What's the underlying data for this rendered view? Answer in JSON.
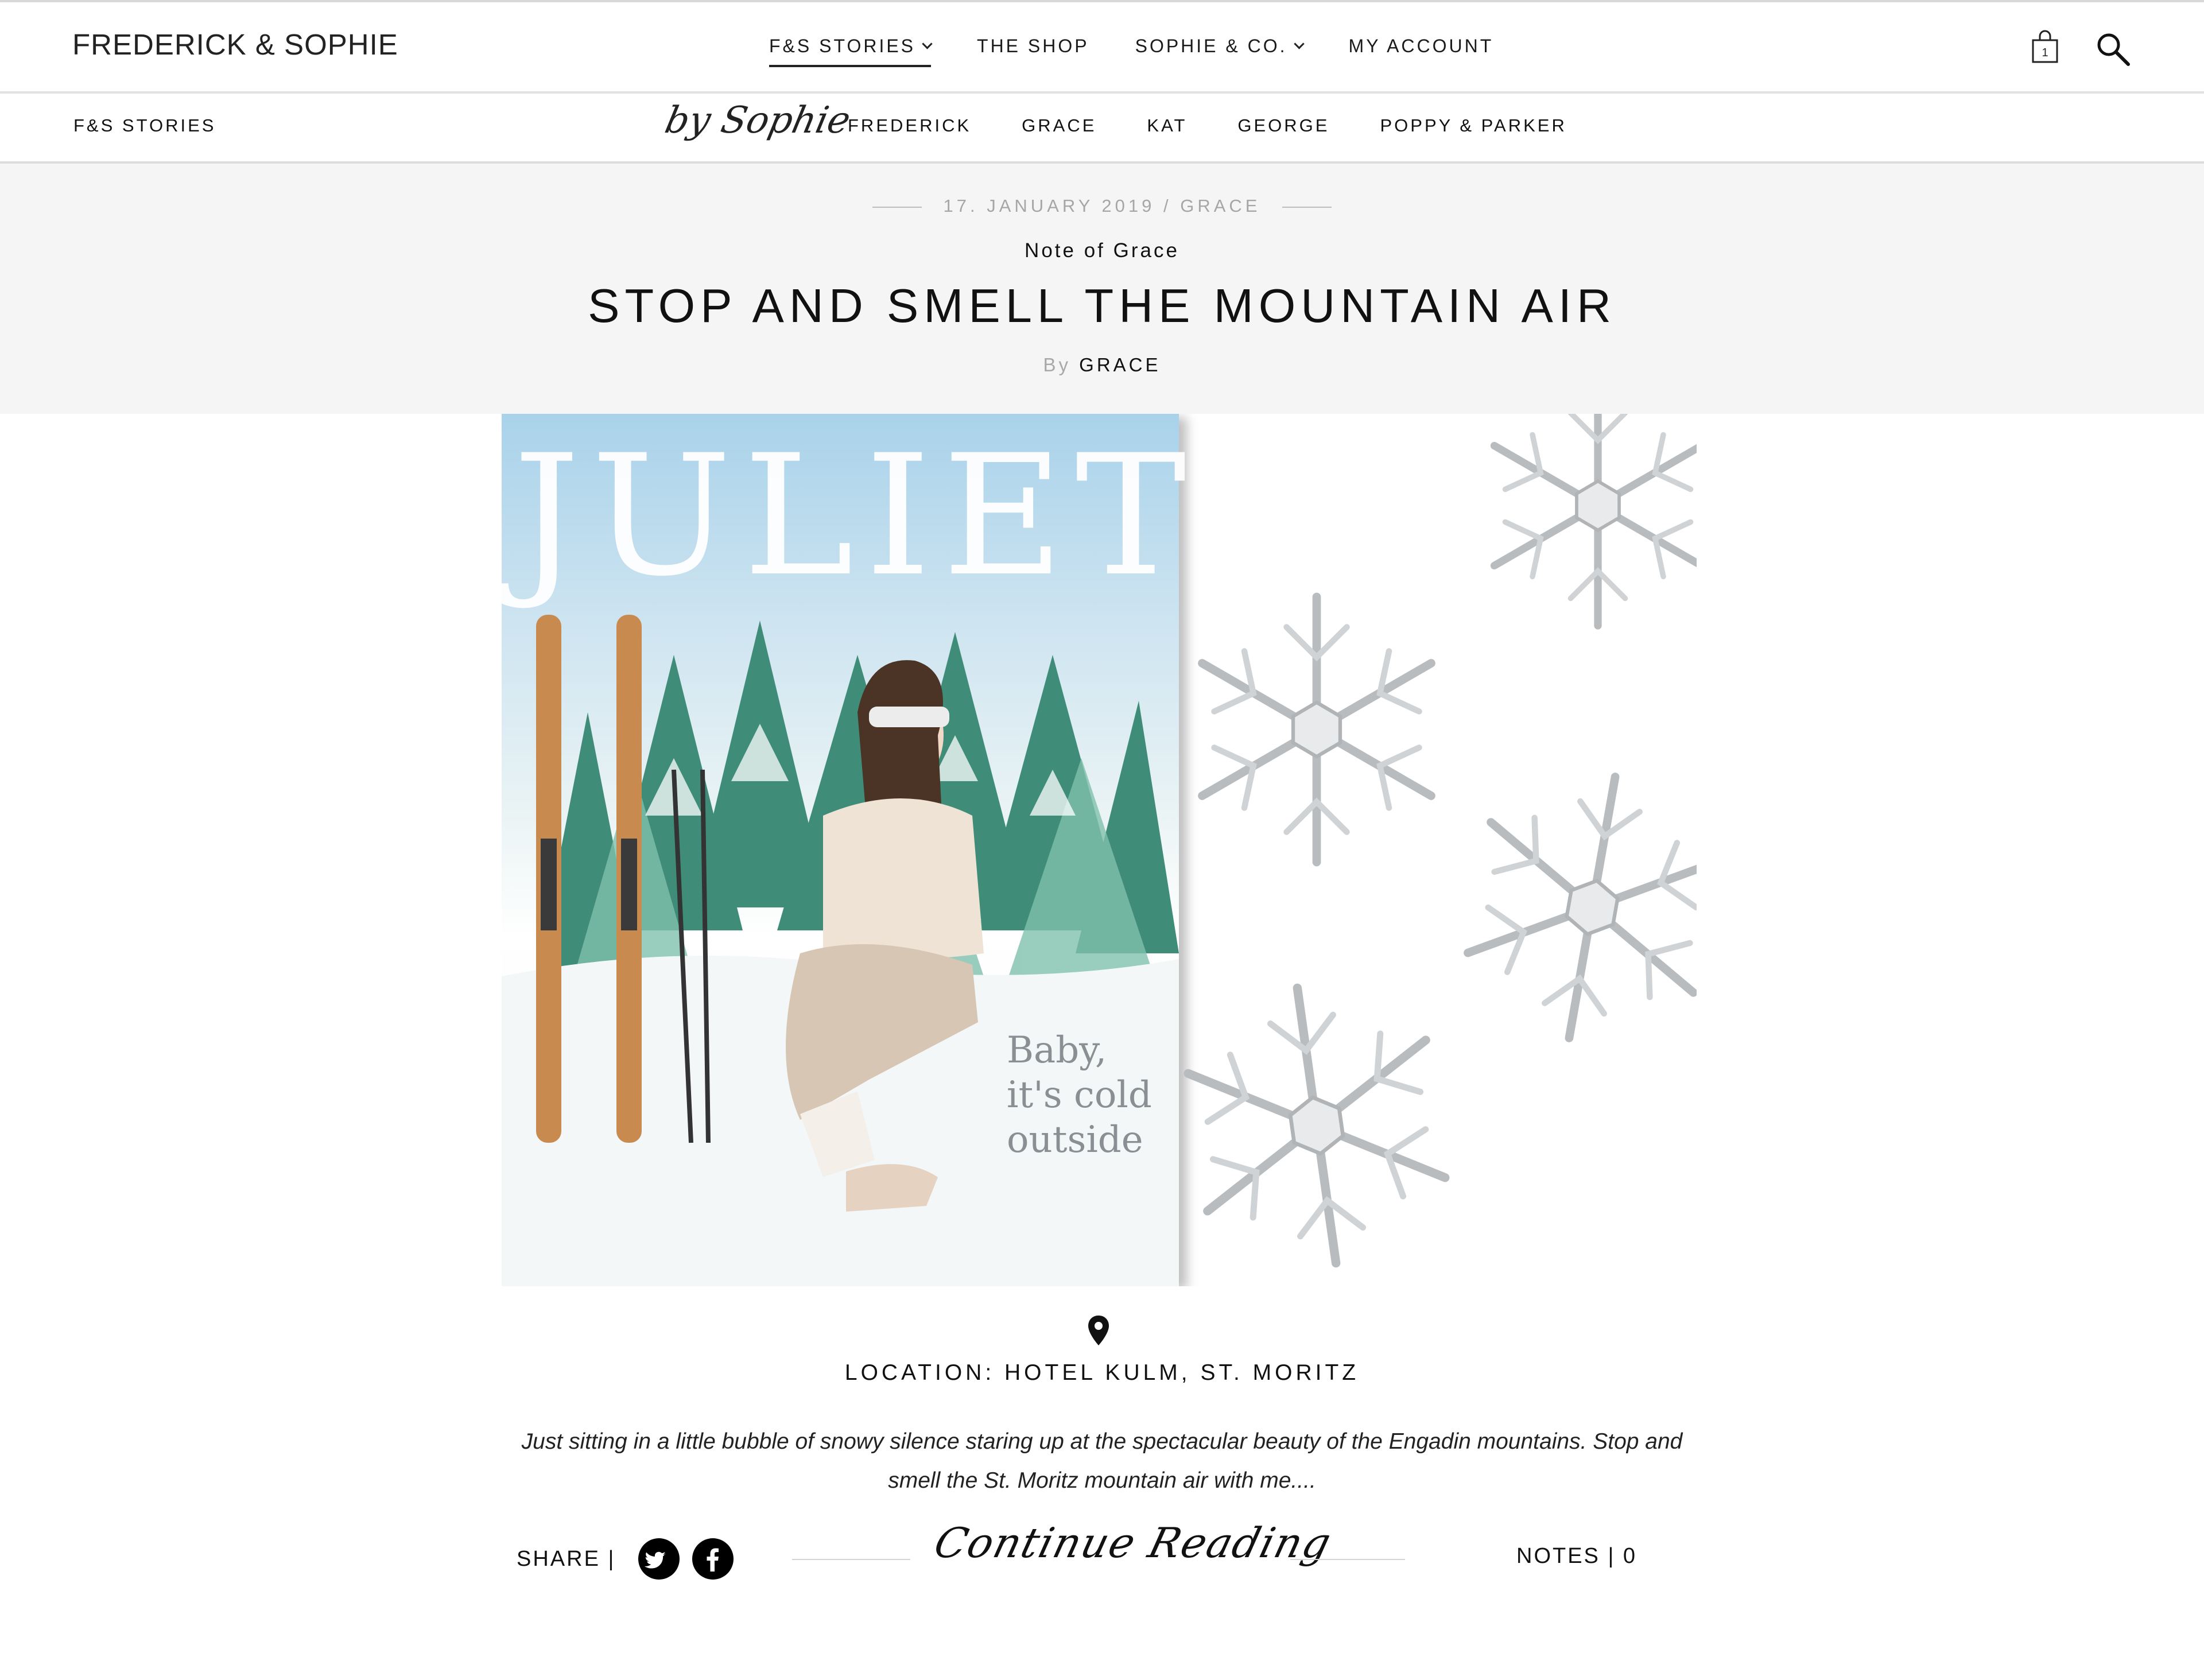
{
  "header": {
    "logo": "FREDERICK & SOPHIE",
    "nav": [
      "F&S STORIES",
      "THE SHOP",
      "SOPHIE & CO.",
      "MY ACCOUNT"
    ],
    "cart_count": "1"
  },
  "subnav": {
    "section": "F&S STORIES",
    "script_label": "by Sophie",
    "items": [
      "FREDERICK",
      "GRACE",
      "KAT",
      "GEORGE",
      "POPPY & PARKER"
    ]
  },
  "post": {
    "meta": "17. JANUARY 2019 / GRACE",
    "kicker": "Note of Grace",
    "title": "STOP AND SMELL THE MOUNTAIN AIR",
    "by_prefix": "By",
    "author": "GRACE",
    "image": {
      "cover_title": "JULIET",
      "cover_line1": "Baby,",
      "cover_line2": "it's cold",
      "cover_line3": "outside"
    },
    "location": "LOCATION: HOTEL KULM, ST. MORITZ",
    "excerpt": "Just sitting in a little bubble of snowy silence staring up at the spectacular beauty of the Engadin mountains. Stop and smell the St. Moritz mountain air with me....",
    "share_label": "SHARE |",
    "continue_label": "Continue Reading",
    "notes_label": "NOTES | 0"
  },
  "colors": {
    "title_band": "#f5f5f5",
    "text": "#111111",
    "meta": "#a6a6a6"
  }
}
